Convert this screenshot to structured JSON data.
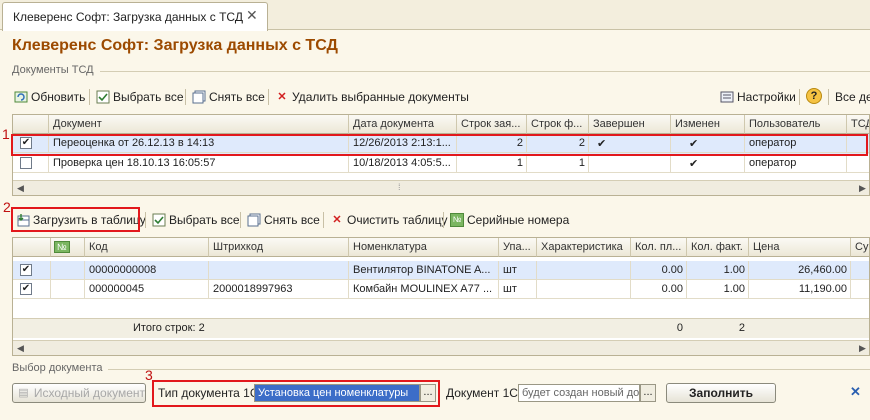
{
  "tab": {
    "title": "Клеверенс Софт: Загрузка данных с ТСД",
    "close": "✕"
  },
  "page_title": "Клеверенс Софт: Загрузка данных с ТСД",
  "docs_section": "Документы ТСД",
  "docs_toolbar": {
    "refresh": "Обновить",
    "select_all": "Выбрать все",
    "deselect_all": "Снять все",
    "delete_selected": "Удалить выбранные документы",
    "settings": "Настройки",
    "help": "?",
    "all_actions": "Все дей"
  },
  "docs_table": {
    "headers": [
      "Документ",
      "Дата документа",
      "Строк зая...",
      "Строк ф...",
      "Завершен",
      "Изменен",
      "Пользователь",
      "ТСД"
    ],
    "rows": [
      {
        "checked": "✔",
        "doc": "Переоценка от 26.12.13 в 14:13",
        "date": "12/26/2013 2:13:1...",
        "req": "2",
        "fact": "2",
        "done": "✔",
        "changed": "✔",
        "user": "оператор"
      },
      {
        "checked": "",
        "doc": "Проверка цен 18.10.13 16:05:57",
        "date": "10/18/2013 4:05:5...",
        "req": "1",
        "fact": "1",
        "done": "",
        "changed": "✔",
        "user": "оператор"
      }
    ]
  },
  "items_toolbar": {
    "load_to_table": "Загрузить в таблицу",
    "select_all": "Выбрать все",
    "deselect_all": "Снять все",
    "clear_table": "Очистить таблицу",
    "serial_numbers": "Серийные номера"
  },
  "items_table": {
    "num_header": "№",
    "headers": [
      "Код",
      "Штрихкод",
      "Номенклатура",
      "Упа...",
      "Характеристика",
      "Кол. пл...",
      "Кол. факт.",
      "Цена",
      "Су"
    ],
    "rows": [
      {
        "checked": "✔",
        "code": "00000000008",
        "barcode": "",
        "name": "Вентилятор BINATONE A...",
        "unit": "шт",
        "char": "",
        "qty_plan": "0.00",
        "qty_fact": "1.00",
        "price": "26,460.00"
      },
      {
        "checked": "✔",
        "code": "000000045",
        "barcode": "2000018997963",
        "name": "Комбайн MOULINEX A77 ...",
        "unit": "шт",
        "char": "",
        "qty_plan": "0.00",
        "qty_fact": "1.00",
        "price": "11,190.00"
      }
    ],
    "footer_label": "Итого строк: 2",
    "footer_plan": "0",
    "footer_fact": "2"
  },
  "doc_select": {
    "section": "Выбор документа",
    "source_button": "Исходный документ",
    "type_label": "Тип документа 1С:",
    "type_value": "Установка цен номенклатуры",
    "doc_label": "Документ 1С:",
    "doc_placeholder": "будет создан новый до",
    "fill_button": "Заполнить"
  },
  "callouts": [
    "1",
    "2",
    "3"
  ],
  "colors": {
    "title": "#9c4a00",
    "highlight": "#e2181c",
    "selection": "#dfeafc"
  }
}
